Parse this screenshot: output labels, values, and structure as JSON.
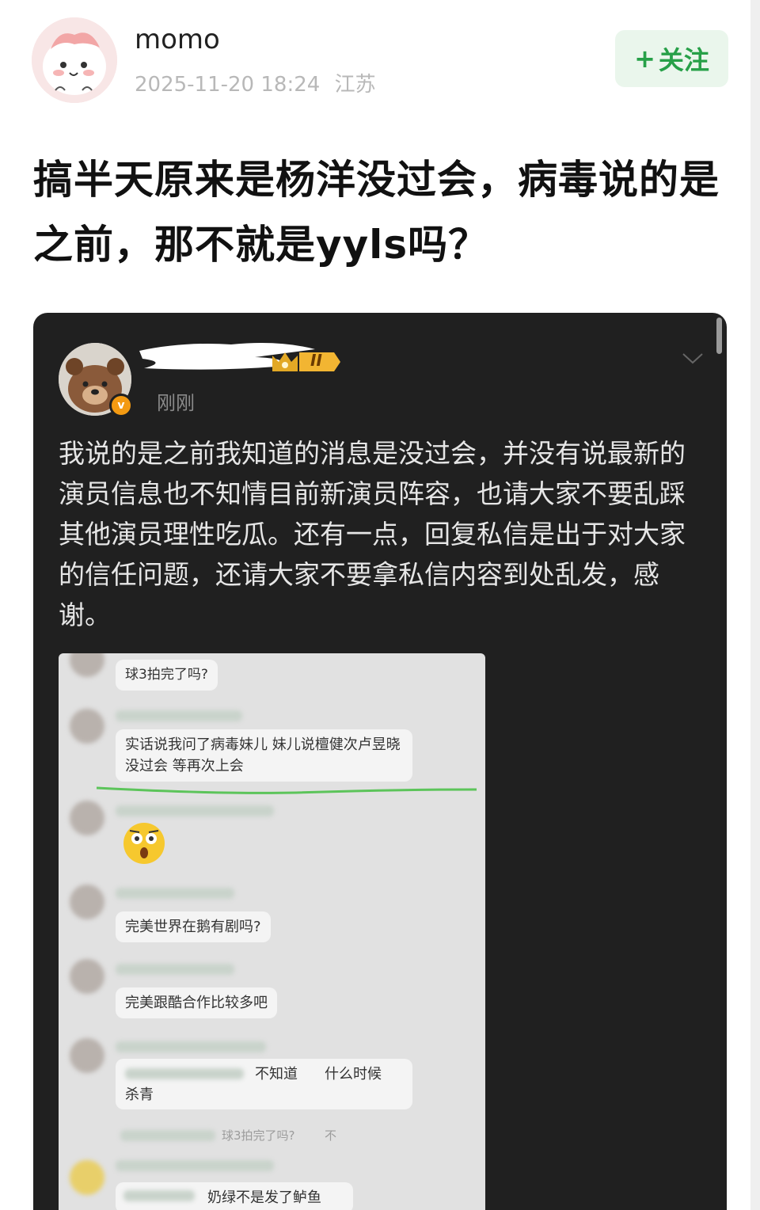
{
  "post": {
    "username": "momo",
    "timestamp": "2025-11-20 18:24",
    "location": "江苏",
    "follow_label": "关注",
    "follow_plus": "+",
    "title": "搞半天原来是杨洋没过会，病毒说的是之前，那不就是yyls吗？"
  },
  "embedded": {
    "level_badge": "II",
    "time": "刚刚",
    "verified_mark": "v",
    "text": "我说的是之前我知道的消息是没过会，并没有说最新的演员信息也不知情目前新演员阵容，也请大家不要乱踩其他演员理性吃瓜。还有一点，回复私信是出于对大家的信任问题，还请大家不要拿私信内容到处乱发，感谢。"
  },
  "chat": {
    "msg1": "球3拍完了吗?",
    "msg2": "实话说我问了病毒妹儿 妹儿说檀健次卢昱晓没过会 等再次上会",
    "msg3": "完美世界在鹅有剧吗?",
    "msg4": "完美跟酷合作比较多吧",
    "msg5_a": "不知道",
    "msg5_b": "什么时候",
    "msg5_c": "杀青",
    "msg6": "球3拍完了吗?",
    "msg6_tail": "不",
    "msg7": "奶绿不是发了鲈鱼"
  },
  "colors": {
    "follow_green": "#27a048",
    "follow_bg": "#eaf6ec",
    "dark_bg": "#202020",
    "chat_bg": "#e1e1e1",
    "highlight_line": "#5cc45a"
  },
  "icons": [
    "avatar-pig",
    "plus-icon",
    "crown-icon",
    "verified-icon",
    "chevron-down-icon",
    "shocked-emoji-icon"
  ]
}
